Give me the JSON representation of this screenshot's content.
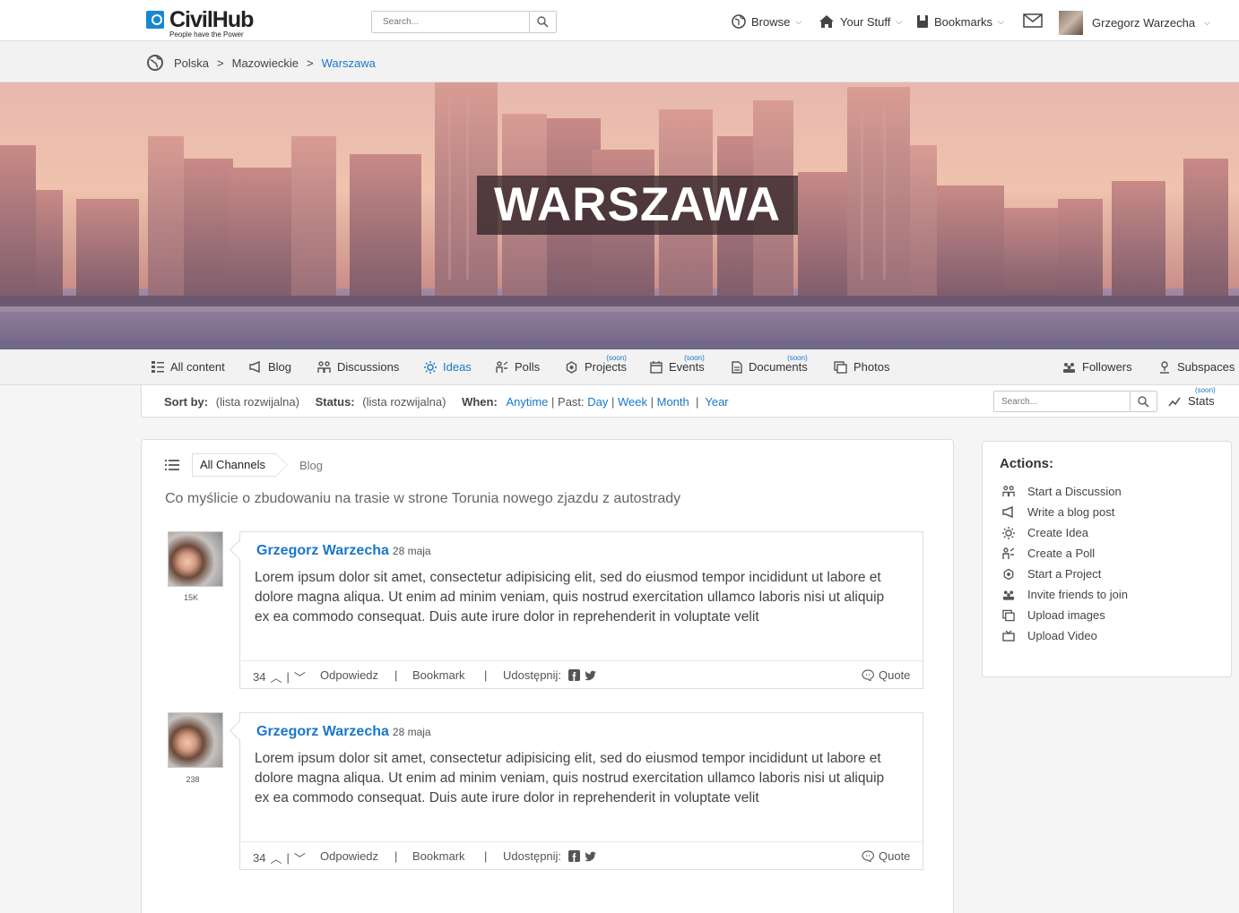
{
  "brand": {
    "name": "CivilHub",
    "tagline": "People have the Power"
  },
  "top_search": {
    "placeholder": "Search..."
  },
  "top_nav": {
    "browse": "Browse",
    "your_stuff": "Your Stuff",
    "bookmarks": "Bookmarks",
    "user_name": "Grzegorz Warzecha"
  },
  "breadcrumb": [
    "Polska",
    ">",
    "Mazowieckie",
    ">",
    "Warszawa"
  ],
  "hero": {
    "title": "WARSZAWA"
  },
  "tabs": [
    {
      "label": "All content",
      "icon": "list-icon"
    },
    {
      "label": "Blog",
      "icon": "megaphone-icon"
    },
    {
      "label": "Discussions",
      "icon": "discussion-icon"
    },
    {
      "label": "Ideas",
      "icon": "lightbulb-icon",
      "active": true
    },
    {
      "label": "Polls",
      "icon": "poll-icon"
    },
    {
      "label": "Projects",
      "icon": "project-icon",
      "soon": "(soon)"
    },
    {
      "label": "Events",
      "icon": "calendar-icon",
      "soon": "(soon)"
    },
    {
      "label": "Documents",
      "icon": "document-icon",
      "soon": "(soon)"
    },
    {
      "label": "Photos",
      "icon": "photos-icon"
    }
  ],
  "tabs_right": {
    "followers": "Followers",
    "subspaces": "Subspaces"
  },
  "filters": {
    "sort_label": "Sort by:",
    "sort_value": "(lista rozwijalna)",
    "status_label": "Status:",
    "status_value": "(lista rozwijalna)",
    "when_label": "When:",
    "anytime": "Anytime",
    "past": "| Past:",
    "day": "Day",
    "week": "Week",
    "month": "Month",
    "year": "Year",
    "search_placeholder": "Search...",
    "stats": "Stats",
    "stats_soon": "(soon)"
  },
  "channels": {
    "all": "All Channels",
    "blog": "Blog"
  },
  "question": "Co myślicie o zbudowaniu na trasie w strone Torunia nowego zjazdu z autostrady",
  "posts": [
    {
      "author": "Grzegorz Warzecha",
      "date": "28 maja",
      "count": "15K",
      "body": "Lorem ipsum dolor sit amet, consectetur adipisicing elit, sed do eiusmod tempor incididunt ut labore et dolore magna aliqua. Ut enim ad minim veniam, quis nostrud exercitation ullamco laboris nisi ut aliquip ex ea commodo consequat. Duis aute irure dolor in reprehenderit in voluptate velit",
      "votes": "34",
      "reply": "Odpowiedz",
      "bookmark": "Bookmark",
      "share": "Udostępnij:",
      "quote": "Quote"
    },
    {
      "author": "Grzegorz Warzecha",
      "date": "28 maja",
      "count": "238",
      "body": "Lorem ipsum dolor sit amet, consectetur adipisicing elit, sed do eiusmod tempor incididunt ut labore et dolore magna aliqua. Ut enim ad minim veniam, quis nostrud exercitation ullamco laboris nisi ut aliquip ex ea commodo consequat. Duis aute irure dolor in reprehenderit in voluptate velit",
      "votes": "34",
      "reply": "Odpowiedz",
      "bookmark": "Bookmark",
      "share": "Udostępnij:",
      "quote": "Quote"
    }
  ],
  "actions": {
    "title": "Actions:",
    "items": [
      {
        "label": "Start a Discussion",
        "icon": "discussion-icon"
      },
      {
        "label": "Write a blog post",
        "icon": "megaphone-icon"
      },
      {
        "label": "Create Idea",
        "icon": "lightbulb-icon"
      },
      {
        "label": "Create a Poll",
        "icon": "poll-icon"
      },
      {
        "label": "Start a Project",
        "icon": "project-icon"
      },
      {
        "label": "Invite friends to join",
        "icon": "group-icon"
      },
      {
        "label": "Upload images",
        "icon": "images-icon"
      },
      {
        "label": "Upload Video",
        "icon": "video-icon"
      }
    ]
  },
  "colors": {
    "accent": "#1a77c9",
    "brand": "#1a86d0"
  }
}
